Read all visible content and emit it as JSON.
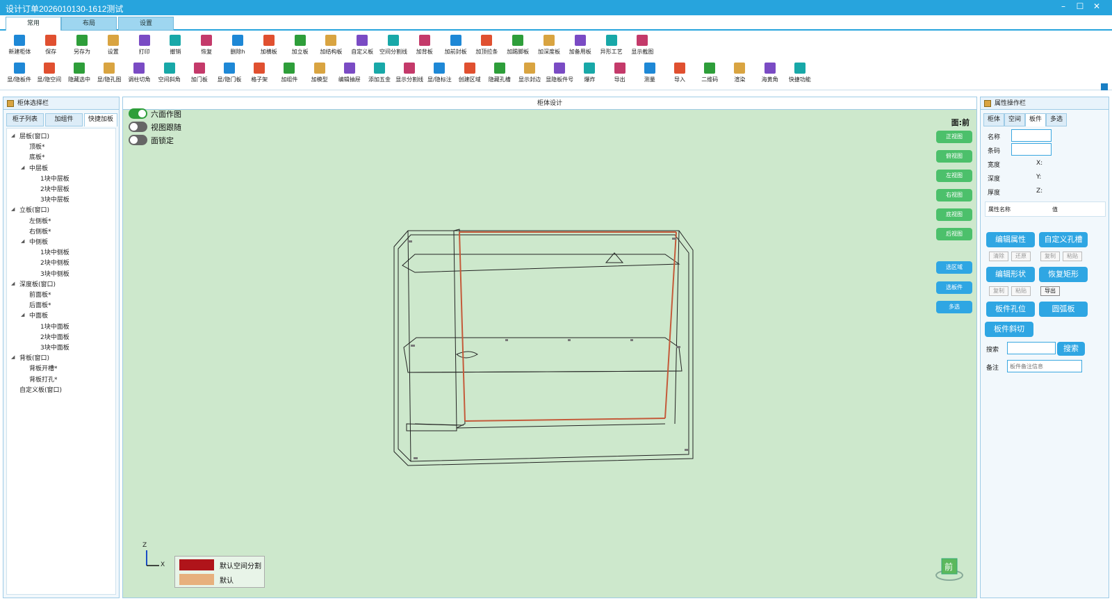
{
  "window": {
    "title": "设计订单2026010130-1612测试",
    "controls": [
      "–",
      "☐",
      "✕"
    ]
  },
  "tabs": [
    {
      "label": "常用",
      "active": true
    },
    {
      "label": "布局",
      "active": false
    },
    {
      "label": "设置",
      "active": false
    }
  ],
  "toolbar_row1": [
    {
      "label": "新建柜体",
      "icon": "new-cabinet-icon"
    },
    {
      "label": "保存",
      "icon": "save-icon"
    },
    {
      "label": "另存为",
      "icon": "save-as-icon"
    },
    {
      "label": "设置",
      "icon": "settings-icon"
    },
    {
      "label": "打印",
      "icon": "print-icon"
    },
    {
      "label": "撤销",
      "icon": "undo-icon"
    },
    {
      "label": "恢复",
      "icon": "redo-icon"
    },
    {
      "label": "删除h",
      "icon": "delete-icon"
    },
    {
      "label": "加横板",
      "icon": "add-horizontal-board-icon"
    },
    {
      "label": "加立板",
      "icon": "add-vertical-board-icon"
    },
    {
      "label": "加结构板",
      "icon": "add-structure-board-icon"
    },
    {
      "label": "自定义板",
      "icon": "custom-board-icon"
    },
    {
      "label": "空间分割线",
      "icon": "space-divider-icon"
    },
    {
      "label": "加背板",
      "icon": "add-back-board-icon"
    },
    {
      "label": "加前封板",
      "icon": "add-front-seal-icon"
    },
    {
      "label": "加顶拉条",
      "icon": "add-top-strip-icon"
    },
    {
      "label": "加踢脚板",
      "icon": "add-kickboard-icon"
    },
    {
      "label": "加深度板",
      "icon": "add-depth-board-icon"
    },
    {
      "label": "加备用板",
      "icon": "add-spare-board-icon"
    },
    {
      "label": "异形工艺",
      "icon": "special-shape-icon"
    },
    {
      "label": "显示截图",
      "icon": "show-screenshot-icon"
    }
  ],
  "toolbar_row2": [
    {
      "label": "显/隐板件",
      "icon": "toggle-boards-icon"
    },
    {
      "label": "显/隐空间",
      "icon": "toggle-space-icon"
    },
    {
      "label": "隐藏选中",
      "icon": "hide-selected-icon"
    },
    {
      "label": "显/隐孔图",
      "icon": "toggle-holes-icon"
    },
    {
      "label": "调柱切角",
      "icon": "pillar-cut-icon"
    },
    {
      "label": "空间斜角",
      "icon": "space-bevel-icon"
    },
    {
      "label": "加门板",
      "icon": "add-door-icon"
    },
    {
      "label": "显/隐门板",
      "icon": "toggle-doors-icon"
    },
    {
      "label": "格子架",
      "icon": "grid-rack-icon"
    },
    {
      "label": "加组件",
      "icon": "add-component-icon"
    },
    {
      "label": "加模型",
      "icon": "add-model-icon"
    },
    {
      "label": "编辑抽屉",
      "icon": "edit-drawer-icon"
    },
    {
      "label": "添加五金",
      "icon": "add-hardware-icon"
    },
    {
      "label": "显示分割线",
      "icon": "show-divider-icon"
    },
    {
      "label": "显/隐标注",
      "icon": "toggle-dimensions-icon"
    },
    {
      "label": "创建区域",
      "icon": "create-region-icon"
    },
    {
      "label": "隐藏孔槽",
      "icon": "hide-slots-icon"
    },
    {
      "label": "显示封边",
      "icon": "show-edge-icon"
    },
    {
      "label": "显隐板件号",
      "icon": "toggle-board-number-icon"
    },
    {
      "label": "爆炸",
      "icon": "explode-icon"
    },
    {
      "label": "导出",
      "icon": "export-icon"
    },
    {
      "label": "测量",
      "icon": "measure-icon"
    },
    {
      "label": "导入",
      "icon": "import-icon"
    },
    {
      "label": "二维码",
      "icon": "qrcode-icon"
    },
    {
      "label": "渲染",
      "icon": "render-icon"
    },
    {
      "label": "海黄角",
      "icon": "corner-icon"
    },
    {
      "label": "快捷功能",
      "icon": "quick-function-icon"
    }
  ],
  "left_panel": {
    "title": "柜体选择栏",
    "tabs": [
      {
        "label": "柜子列表",
        "active": false
      },
      {
        "label": "加组件",
        "active": false
      },
      {
        "label": "快捷加板",
        "active": true
      }
    ],
    "tree": [
      {
        "label": "层板(窗口)",
        "level": 0,
        "expanded": true
      },
      {
        "label": "顶板*",
        "level": 1
      },
      {
        "label": "底板*",
        "level": 1
      },
      {
        "label": "中层板",
        "level": 1,
        "expanded": true
      },
      {
        "label": "1块中层板",
        "level": 2
      },
      {
        "label": "2块中层板",
        "level": 2
      },
      {
        "label": "3块中层板",
        "level": 2
      },
      {
        "label": "立板(窗口)",
        "level": 0,
        "expanded": true
      },
      {
        "label": "左侧板*",
        "level": 1
      },
      {
        "label": "右侧板*",
        "level": 1
      },
      {
        "label": "中侧板",
        "level": 1,
        "expanded": true
      },
      {
        "label": "1块中侧板",
        "level": 2
      },
      {
        "label": "2块中侧板",
        "level": 2
      },
      {
        "label": "3块中侧板",
        "level": 2
      },
      {
        "label": "深度板(窗口)",
        "level": 0,
        "expanded": true
      },
      {
        "label": "前面板*",
        "level": 1
      },
      {
        "label": "后面板*",
        "level": 1
      },
      {
        "label": "中面板",
        "level": 1,
        "expanded": true
      },
      {
        "label": "1块中面板",
        "level": 2
      },
      {
        "label": "2块中面板",
        "level": 2
      },
      {
        "label": "3块中面板",
        "level": 2
      },
      {
        "label": "背板(窗口)",
        "level": 0,
        "expanded": true
      },
      {
        "label": "背板开槽*",
        "level": 1
      },
      {
        "label": "背板打孔*",
        "level": 1
      },
      {
        "label": "自定义板(窗口)",
        "level": 0
      }
    ]
  },
  "center": {
    "title": "柜体设计",
    "toggles": [
      {
        "label": "六面作图",
        "on": true
      },
      {
        "label": "视图跟随",
        "on": false
      },
      {
        "label": "面锁定",
        "on": false
      }
    ],
    "face_label": "面:前",
    "view_buttons": [
      "正视图",
      "俯视图",
      "左视图",
      "右视图",
      "底视图",
      "后视图"
    ],
    "select_buttons": [
      "选区域",
      "选板件",
      "多选"
    ],
    "legend": [
      {
        "label": "默认空间分割",
        "color": "#b0141a"
      },
      {
        "label": "默认",
        "color": "#e7b07d"
      }
    ],
    "axes": {
      "z": "Z",
      "x": "X"
    },
    "cube_label": "前"
  },
  "right_panel": {
    "title": "属性操作栏",
    "tabs": [
      {
        "label": "柜体",
        "active": false
      },
      {
        "label": "空间",
        "active": false
      },
      {
        "label": "板件",
        "active": true
      },
      {
        "label": "多选",
        "active": false
      }
    ],
    "fields": {
      "name_label": "名称",
      "name_value": "",
      "barcode_label": "条码",
      "barcode_value": "",
      "width_label": "宽度",
      "x_label": "X:",
      "depth_label": "深度",
      "y_label": "Y:",
      "thickness_label": "厚度",
      "z_label": "Z:"
    },
    "prop_table": {
      "col1": "属性名称",
      "col2": "值"
    },
    "buttons": {
      "edit_props": "编辑属性",
      "custom_slot": "自定义孔槽",
      "clear": "清除",
      "restore": "还原",
      "copy1": "复制",
      "paste1": "粘贴",
      "edit_shape": "编辑形状",
      "restore_rect": "恢复矩形",
      "copy2": "复制",
      "paste2": "粘贴",
      "export": "导出",
      "board_holes": "板件孔位",
      "arc_board": "圆弧板",
      "board_bevel": "板件斜切",
      "search_label": "搜索",
      "search_button": "搜索",
      "note_label": "备注",
      "note_placeholder": "板件备注信息"
    }
  }
}
